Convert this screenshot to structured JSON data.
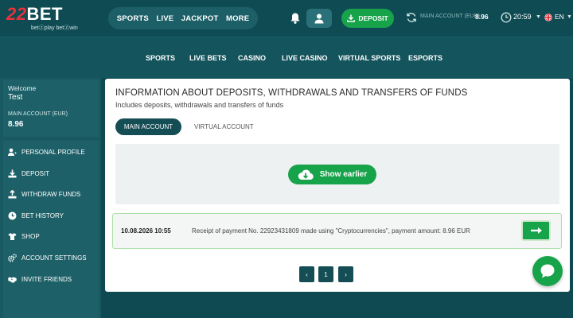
{
  "brand": {
    "logo_text": "22BET",
    "tagline": "betⓩplay  betⓩwin"
  },
  "top_nav": {
    "items": [
      "SPORTS",
      "LIVE",
      "JACKPOT",
      "MORE"
    ]
  },
  "header": {
    "deposit_label": "DEPOSIT",
    "account_label": "MAIN ACCOUNT (EUR)",
    "account_amount": "8.96",
    "time": "20:59",
    "language": "EN"
  },
  "sub_nav": {
    "items": [
      "SPORTS",
      "LIVE BETS",
      "CASINO",
      "LIVE CASINO",
      "VIRTUAL SPORTS",
      "ESPORTS"
    ]
  },
  "sidebar": {
    "welcome": "Welcome",
    "username": "Test",
    "account_label": "MAIN ACCOUNT (EUR)",
    "balance": "8.96",
    "menu": [
      {
        "label": "PERSONAL PROFILE",
        "icon": "user-icon"
      },
      {
        "label": "DEPOSIT",
        "icon": "download-icon"
      },
      {
        "label": "WITHDRAW FUNDS",
        "icon": "upload-icon"
      },
      {
        "label": "BET HISTORY",
        "icon": "clock-icon"
      },
      {
        "label": "SHOP",
        "icon": "shirt-icon"
      },
      {
        "label": "ACCOUNT SETTINGS",
        "icon": "gears-icon"
      },
      {
        "label": "INVITE FRIENDS",
        "icon": "handshake-icon"
      }
    ]
  },
  "main": {
    "title": "INFORMATION ABOUT DEPOSITS, WITHDRAWALS AND TRANSFERS OF FUNDS",
    "subtitle": "Includes deposits, withdrawals and transfers of funds",
    "tabs": [
      {
        "label": "MAIN ACCOUNT",
        "active": true
      },
      {
        "label": "VIRTUAL ACCOUNT",
        "active": false
      }
    ],
    "show_earlier_label": "Show earlier",
    "transactions": [
      {
        "datetime": "10.08.2026 10:55",
        "description": "Receipt of payment No. 22923431809 made using \"Cryptocurrencies\", payment amount: 8.96 EUR"
      }
    ],
    "pagination": {
      "prev": "‹",
      "current": "1",
      "next": "›"
    }
  },
  "colors": {
    "background": "#0f4a52",
    "accent_green": "#16a34a",
    "brand_red": "#e8323c",
    "panel_teal": "#1d6068",
    "active_tab": "#154d55"
  }
}
